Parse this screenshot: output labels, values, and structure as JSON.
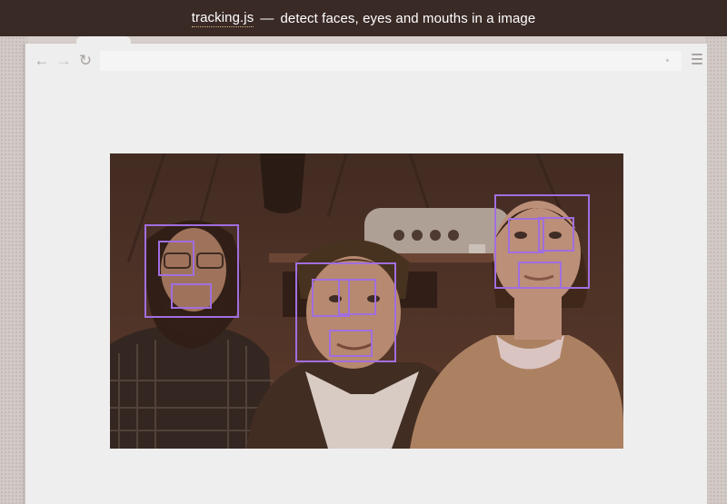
{
  "header": {
    "link_text": "tracking.js",
    "separator": "—",
    "description": "detect faces, eyes and mouths in a image"
  },
  "browser": {
    "nav": {
      "back_icon": "←",
      "forward_icon": "→",
      "reload_icon": "↻"
    }
  },
  "colors": {
    "title_bar": "#3a2a26",
    "detection_box": "#a16ee0",
    "page_background": "#efeeee"
  }
}
